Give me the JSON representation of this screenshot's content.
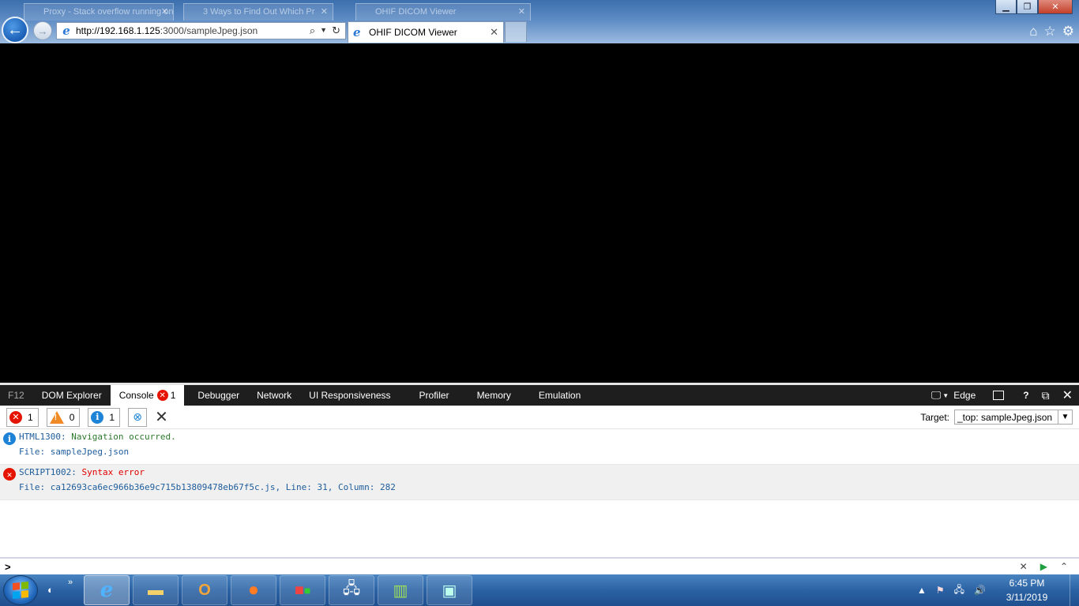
{
  "browser": {
    "background_tabs": [
      "Proxy - Stack overflow running on Cl",
      "3 Ways to Find Out Which Pr",
      "OHIF DICOM Viewer"
    ],
    "address_host": "http://192.168.1.125",
    "address_path": ":3000/sampleJpeg.json",
    "active_tab_title": "OHIF DICOM Viewer",
    "window_controls": {
      "minimize": "▁",
      "restore": "❐",
      "close": "✕"
    },
    "toolbar_icons": [
      "home-icon",
      "star-icon",
      "gear-icon"
    ]
  },
  "devtools": {
    "tabs": [
      {
        "label": "F12"
      },
      {
        "label": "DOM Explorer"
      },
      {
        "label": "Console",
        "badge": "1"
      },
      {
        "label": "Debugger"
      },
      {
        "label": "Network"
      },
      {
        "label": "UI Responsiveness"
      },
      {
        "label": "Profiler"
      },
      {
        "label": "Memory"
      },
      {
        "label": "Emulation"
      }
    ],
    "doc_mode": "Edge",
    "help": "?",
    "filters": {
      "errors": "1",
      "warnings": "0",
      "info": "1"
    },
    "target_label": "Target:",
    "target_value": "_top: sampleJpeg.json",
    "messages": [
      {
        "type": "info",
        "code": "HTML1300:",
        "text": "Navigation occurred.",
        "file_line": "File: sampleJpeg.json"
      },
      {
        "type": "error",
        "code": "SCRIPT1002:",
        "text": "Syntax error",
        "file_line": "File: ca12693ca6ec966b36e9c715b13809478eb67f5c.js, Line: 31, Column: 282"
      }
    ],
    "prompt": ">"
  },
  "taskbar": {
    "time": "6:45 PM",
    "date": "3/11/2019"
  }
}
